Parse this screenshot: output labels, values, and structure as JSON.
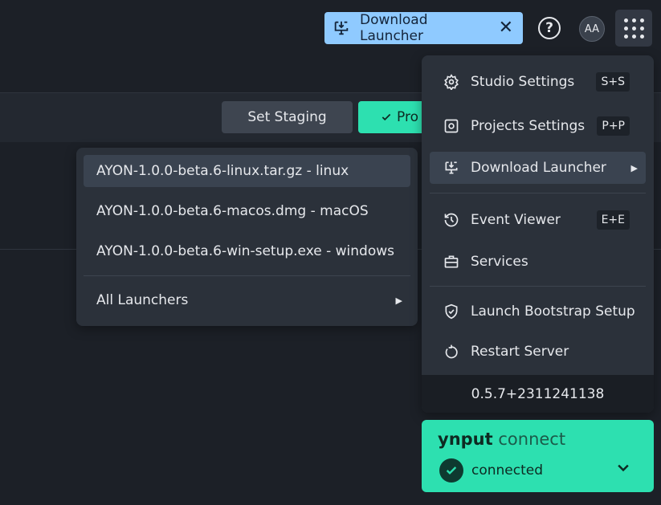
{
  "topbar": {
    "download_chip": {
      "label": "Download Launcher",
      "close": "✕",
      "color": "#8fcaff"
    },
    "help_icon": "?",
    "avatar": "AA",
    "apps_icon": "apps-grid-icon"
  },
  "band": {
    "set_staging": "Set Staging",
    "production": "Pro"
  },
  "launcher_submenu": {
    "items": [
      {
        "label": "AYON-1.0.0-beta.6-linux.tar.gz - linux"
      },
      {
        "label": "AYON-1.0.0-beta.6-macos.dmg - macOS"
      },
      {
        "label": "AYON-1.0.0-beta.6-win-setup.exe - windows"
      }
    ],
    "all_launchers": "All Launchers"
  },
  "menu": {
    "items": [
      {
        "label": "Studio Settings",
        "icon": "gear-icon",
        "shortcut": "S+S"
      },
      {
        "label": "Projects Settings",
        "icon": "settings-box-icon",
        "shortcut": "P+P"
      },
      {
        "label": "Download Launcher",
        "icon": "install-desktop-icon"
      },
      {
        "label": "Event Viewer",
        "icon": "history-icon",
        "shortcut": "E+E"
      },
      {
        "label": "Services",
        "icon": "briefcase-icon"
      },
      {
        "label": "Launch Bootstrap Setup",
        "icon": "shield-check-icon"
      },
      {
        "label": "Restart Server",
        "icon": "restart-icon"
      }
    ],
    "version": "0.5.7+2311241138"
  },
  "connect": {
    "brand_bold": "ynput",
    "brand_rest": "connect",
    "status": "connected",
    "color": "#2de0b0"
  }
}
